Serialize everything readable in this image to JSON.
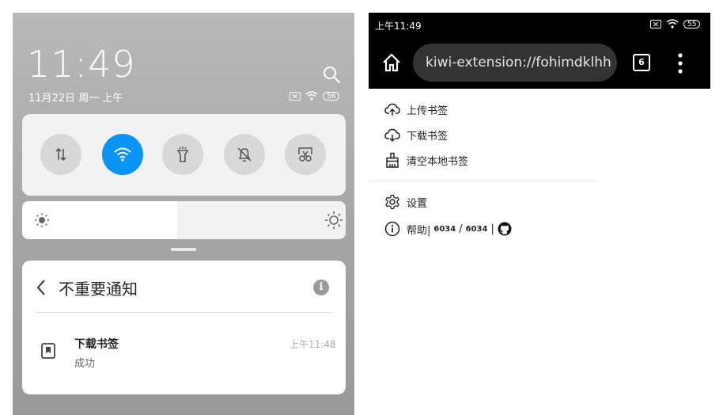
{
  "left_phone": {
    "clock": "11:49",
    "date": "11月22日 周一 上午",
    "battery": "56",
    "quick_settings": [
      {
        "icon": "data-transfer-icon",
        "active": false
      },
      {
        "icon": "wifi-icon",
        "active": true
      },
      {
        "icon": "flashlight-icon",
        "active": false
      },
      {
        "icon": "bell-off-icon",
        "active": false
      },
      {
        "icon": "screenshot-crop-icon",
        "active": false
      }
    ],
    "brightness_level": 0.48,
    "notification": {
      "header": "不重要通知",
      "info_glyph": "i",
      "item_title": "下载书签",
      "item_subtitle": "成功",
      "item_time": "上午11:48"
    }
  },
  "right_phone": {
    "status_time": "上午11:49",
    "battery": "55",
    "url": "kiwi-extension://fohimdklhh",
    "tab_count": "6",
    "menu": {
      "upload": "上传书签",
      "download": "下载书签",
      "clear": "清空本地书签",
      "settings": "设置",
      "help": "帮助|",
      "help_count_a": "6034",
      "help_slash": "/",
      "help_count_b": "6034",
      "help_bar": "|"
    }
  },
  "colors": {
    "wifi_active": "#0a94f5",
    "panel": "#f2f2f2",
    "topbar": "#000000",
    "urlbar": "#333333"
  }
}
